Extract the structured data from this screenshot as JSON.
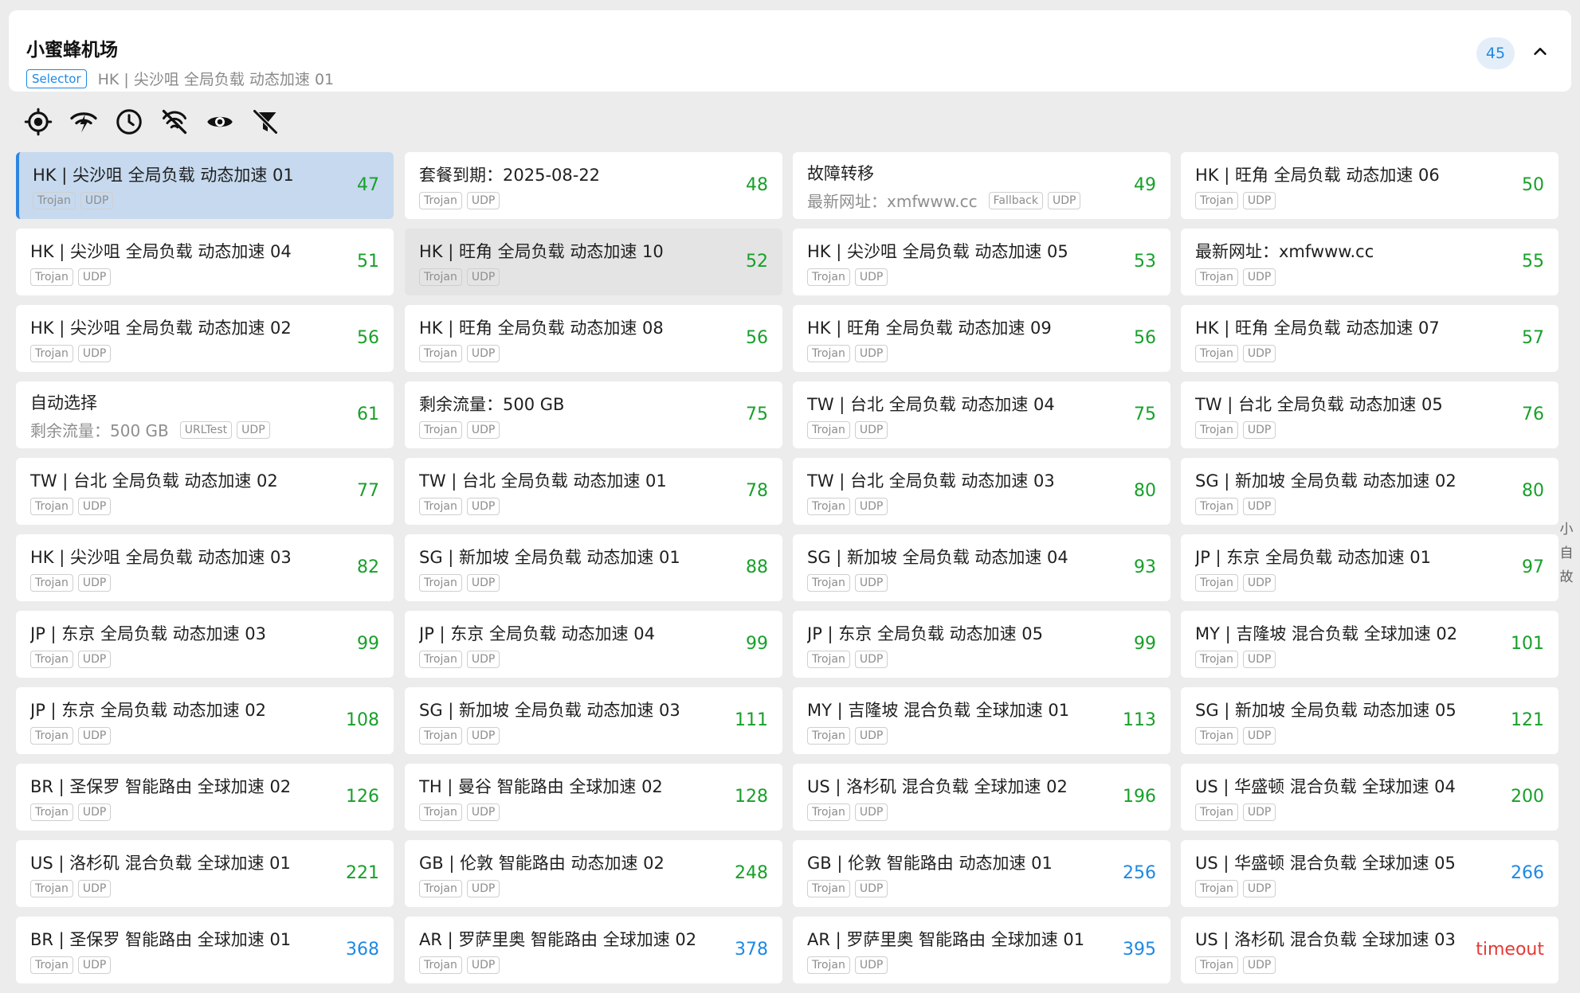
{
  "group": {
    "title": "小蜜蜂机场",
    "type": "Selector",
    "current": "HK | 尖沙咀 全局负载 动态加速 01",
    "count": "45"
  },
  "toolbar": {
    "icons": [
      "locate-icon",
      "delay-test-icon",
      "sort-by-delay-icon",
      "filter-unavailable-icon",
      "visibility-icon",
      "clear-filter-icon"
    ]
  },
  "colors": {
    "good": "#18a02a",
    "medium": "#1e88e5",
    "timeout": "#e53935",
    "accent": "#2f86e0"
  },
  "proxies": [
    {
      "name": "HK | 尖沙咀 全局负载 动态加速 01",
      "sub": "",
      "tags": [
        "Trojan",
        "UDP"
      ],
      "delay": "47",
      "status": "good",
      "state": "selected"
    },
    {
      "name": "套餐到期：2025-08-22",
      "sub": "",
      "tags": [
        "Trojan",
        "UDP"
      ],
      "delay": "48",
      "status": "good",
      "state": ""
    },
    {
      "name": "故障转移",
      "sub": "最新网址：xmfwww.cc",
      "tags": [
        "Fallback",
        "UDP"
      ],
      "delay": "49",
      "status": "good",
      "state": ""
    },
    {
      "name": "HK | 旺角 全局负载 动态加速 06",
      "sub": "",
      "tags": [
        "Trojan",
        "UDP"
      ],
      "delay": "50",
      "status": "good",
      "state": ""
    },
    {
      "name": "HK | 尖沙咀 全局负载 动态加速 04",
      "sub": "",
      "tags": [
        "Trojan",
        "UDP"
      ],
      "delay": "51",
      "status": "good",
      "state": ""
    },
    {
      "name": "HK | 旺角 全局负载 动态加速 10",
      "sub": "",
      "tags": [
        "Trojan",
        "UDP"
      ],
      "delay": "52",
      "status": "good",
      "state": "hover"
    },
    {
      "name": "HK | 尖沙咀 全局负载 动态加速 05",
      "sub": "",
      "tags": [
        "Trojan",
        "UDP"
      ],
      "delay": "53",
      "status": "good",
      "state": ""
    },
    {
      "name": "最新网址：xmfwww.cc",
      "sub": "",
      "tags": [
        "Trojan",
        "UDP"
      ],
      "delay": "55",
      "status": "good",
      "state": ""
    },
    {
      "name": "HK | 尖沙咀 全局负载 动态加速 02",
      "sub": "",
      "tags": [
        "Trojan",
        "UDP"
      ],
      "delay": "56",
      "status": "good",
      "state": ""
    },
    {
      "name": "HK | 旺角 全局负载 动态加速 08",
      "sub": "",
      "tags": [
        "Trojan",
        "UDP"
      ],
      "delay": "56",
      "status": "good",
      "state": ""
    },
    {
      "name": "HK | 旺角 全局负载 动态加速 09",
      "sub": "",
      "tags": [
        "Trojan",
        "UDP"
      ],
      "delay": "56",
      "status": "good",
      "state": ""
    },
    {
      "name": "HK | 旺角 全局负载 动态加速 07",
      "sub": "",
      "tags": [
        "Trojan",
        "UDP"
      ],
      "delay": "57",
      "status": "good",
      "state": ""
    },
    {
      "name": "自动选择",
      "sub": "剩余流量：500 GB",
      "tags": [
        "URLTest",
        "UDP"
      ],
      "delay": "61",
      "status": "good",
      "state": ""
    },
    {
      "name": "剩余流量：500 GB",
      "sub": "",
      "tags": [
        "Trojan",
        "UDP"
      ],
      "delay": "75",
      "status": "good",
      "state": ""
    },
    {
      "name": "TW | 台北 全局负载 动态加速 04",
      "sub": "",
      "tags": [
        "Trojan",
        "UDP"
      ],
      "delay": "75",
      "status": "good",
      "state": ""
    },
    {
      "name": "TW | 台北 全局负载 动态加速 05",
      "sub": "",
      "tags": [
        "Trojan",
        "UDP"
      ],
      "delay": "76",
      "status": "good",
      "state": ""
    },
    {
      "name": "TW | 台北 全局负载 动态加速 02",
      "sub": "",
      "tags": [
        "Trojan",
        "UDP"
      ],
      "delay": "77",
      "status": "good",
      "state": ""
    },
    {
      "name": "TW | 台北 全局负载 动态加速 01",
      "sub": "",
      "tags": [
        "Trojan",
        "UDP"
      ],
      "delay": "78",
      "status": "good",
      "state": ""
    },
    {
      "name": "TW | 台北 全局负载 动态加速 03",
      "sub": "",
      "tags": [
        "Trojan",
        "UDP"
      ],
      "delay": "80",
      "status": "good",
      "state": ""
    },
    {
      "name": "SG | 新加坡 全局负载 动态加速 02",
      "sub": "",
      "tags": [
        "Trojan",
        "UDP"
      ],
      "delay": "80",
      "status": "good",
      "state": ""
    },
    {
      "name": "HK | 尖沙咀 全局负载 动态加速 03",
      "sub": "",
      "tags": [
        "Trojan",
        "UDP"
      ],
      "delay": "82",
      "status": "good",
      "state": ""
    },
    {
      "name": "SG | 新加坡 全局负载 动态加速 01",
      "sub": "",
      "tags": [
        "Trojan",
        "UDP"
      ],
      "delay": "88",
      "status": "good",
      "state": ""
    },
    {
      "name": "SG | 新加坡 全局负载 动态加速 04",
      "sub": "",
      "tags": [
        "Trojan",
        "UDP"
      ],
      "delay": "93",
      "status": "good",
      "state": ""
    },
    {
      "name": "JP | 东京 全局负载 动态加速 01",
      "sub": "",
      "tags": [
        "Trojan",
        "UDP"
      ],
      "delay": "97",
      "status": "good",
      "state": ""
    },
    {
      "name": "JP | 东京 全局负载 动态加速 03",
      "sub": "",
      "tags": [
        "Trojan",
        "UDP"
      ],
      "delay": "99",
      "status": "good",
      "state": ""
    },
    {
      "name": "JP | 东京 全局负载 动态加速 04",
      "sub": "",
      "tags": [
        "Trojan",
        "UDP"
      ],
      "delay": "99",
      "status": "good",
      "state": ""
    },
    {
      "name": "JP | 东京 全局负载 动态加速 05",
      "sub": "",
      "tags": [
        "Trojan",
        "UDP"
      ],
      "delay": "99",
      "status": "good",
      "state": ""
    },
    {
      "name": "MY | 吉隆坡 混合负载 全球加速 02",
      "sub": "",
      "tags": [
        "Trojan",
        "UDP"
      ],
      "delay": "101",
      "status": "good",
      "state": ""
    },
    {
      "name": "JP | 东京 全局负载 动态加速 02",
      "sub": "",
      "tags": [
        "Trojan",
        "UDP"
      ],
      "delay": "108",
      "status": "good",
      "state": ""
    },
    {
      "name": "SG | 新加坡 全局负载 动态加速 03",
      "sub": "",
      "tags": [
        "Trojan",
        "UDP"
      ],
      "delay": "111",
      "status": "good",
      "state": ""
    },
    {
      "name": "MY | 吉隆坡 混合负载 全球加速 01",
      "sub": "",
      "tags": [
        "Trojan",
        "UDP"
      ],
      "delay": "113",
      "status": "good",
      "state": ""
    },
    {
      "name": "SG | 新加坡 全局负载 动态加速 05",
      "sub": "",
      "tags": [
        "Trojan",
        "UDP"
      ],
      "delay": "121",
      "status": "good",
      "state": ""
    },
    {
      "name": "BR | 圣保罗 智能路由 全球加速 02",
      "sub": "",
      "tags": [
        "Trojan",
        "UDP"
      ],
      "delay": "126",
      "status": "good",
      "state": ""
    },
    {
      "name": "TH | 曼谷 智能路由 全球加速 02",
      "sub": "",
      "tags": [
        "Trojan",
        "UDP"
      ],
      "delay": "128",
      "status": "good",
      "state": ""
    },
    {
      "name": "US | 洛杉矶 混合负载 全球加速 02",
      "sub": "",
      "tags": [
        "Trojan",
        "UDP"
      ],
      "delay": "196",
      "status": "good",
      "state": ""
    },
    {
      "name": "US | 华盛顿 混合负载 全球加速 04",
      "sub": "",
      "tags": [
        "Trojan",
        "UDP"
      ],
      "delay": "200",
      "status": "good",
      "state": ""
    },
    {
      "name": "US | 洛杉矶 混合负载 全球加速 01",
      "sub": "",
      "tags": [
        "Trojan",
        "UDP"
      ],
      "delay": "221",
      "status": "good",
      "state": ""
    },
    {
      "name": "GB | 伦敦 智能路由 动态加速 02",
      "sub": "",
      "tags": [
        "Trojan",
        "UDP"
      ],
      "delay": "248",
      "status": "good",
      "state": ""
    },
    {
      "name": "GB | 伦敦 智能路由 动态加速 01",
      "sub": "",
      "tags": [
        "Trojan",
        "UDP"
      ],
      "delay": "256",
      "status": "medium",
      "state": ""
    },
    {
      "name": "US | 华盛顿 混合负载 全球加速 05",
      "sub": "",
      "tags": [
        "Trojan",
        "UDP"
      ],
      "delay": "266",
      "status": "medium",
      "state": ""
    },
    {
      "name": "BR | 圣保罗 智能路由 全球加速 01",
      "sub": "",
      "tags": [
        "Trojan",
        "UDP"
      ],
      "delay": "368",
      "status": "medium",
      "state": ""
    },
    {
      "name": "AR | 罗萨里奥 智能路由 全球加速 02",
      "sub": "",
      "tags": [
        "Trojan",
        "UDP"
      ],
      "delay": "378",
      "status": "medium",
      "state": ""
    },
    {
      "name": "AR | 罗萨里奥 智能路由 全球加速 01",
      "sub": "",
      "tags": [
        "Trojan",
        "UDP"
      ],
      "delay": "395",
      "status": "medium",
      "state": ""
    },
    {
      "name": "US | 洛杉矶 混合负载 全球加速 03",
      "sub": "",
      "tags": [
        "Trojan",
        "UDP"
      ],
      "delay": "timeout",
      "status": "timeout",
      "state": ""
    }
  ],
  "side_index": [
    "小",
    "自",
    "故"
  ]
}
